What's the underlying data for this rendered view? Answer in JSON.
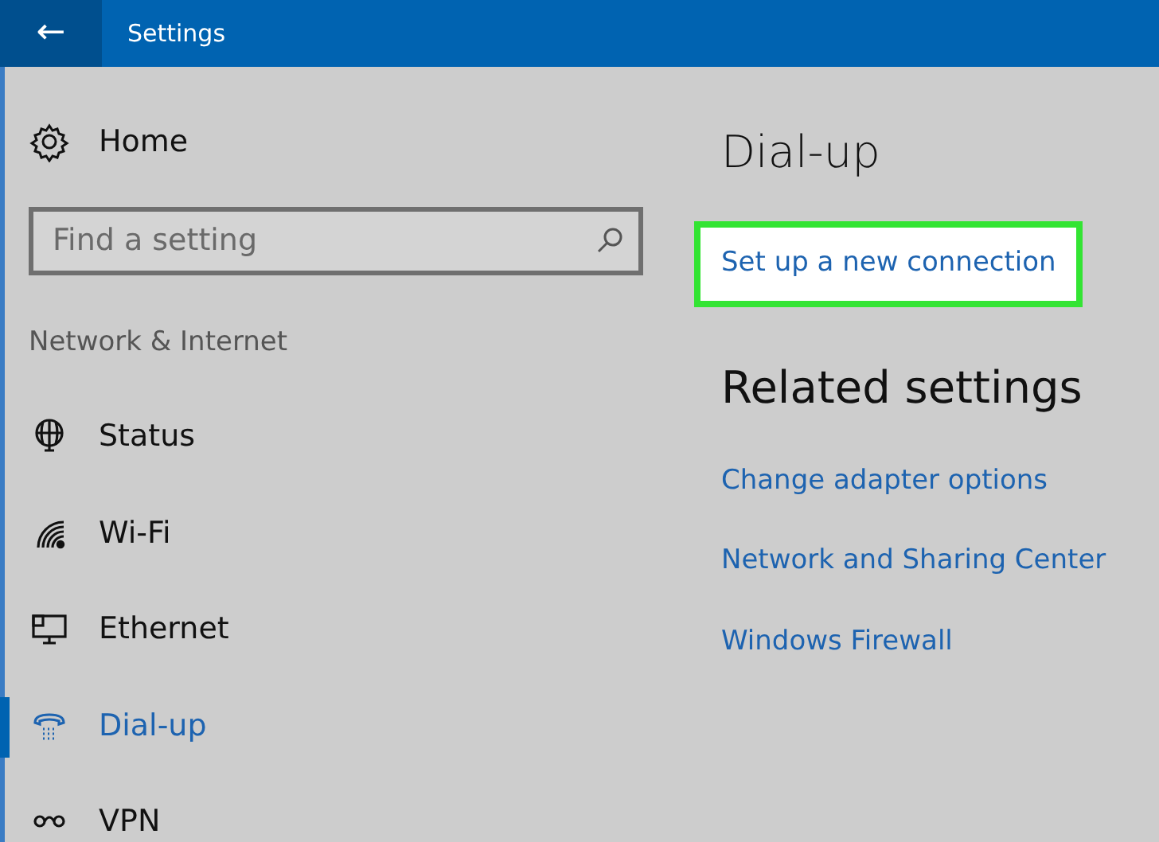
{
  "window": {
    "title": "Settings",
    "back": "←"
  },
  "sidebar": {
    "home": "Home",
    "search": {
      "placeholder": "Find a setting"
    },
    "section": "Network & Internet",
    "items": [
      {
        "label": "Status",
        "selected": false
      },
      {
        "label": "Wi-Fi",
        "selected": false
      },
      {
        "label": "Ethernet",
        "selected": false
      },
      {
        "label": "Dial-up",
        "selected": true
      },
      {
        "label": "VPN",
        "selected": false
      }
    ]
  },
  "content": {
    "title": "Dial-up",
    "primary_link": {
      "label": "Set up a new connection",
      "highlighted": true
    },
    "related": {
      "title": "Related settings",
      "links": [
        "Change adapter options",
        "Network and Sharing Center",
        "Windows Firewall"
      ]
    }
  }
}
